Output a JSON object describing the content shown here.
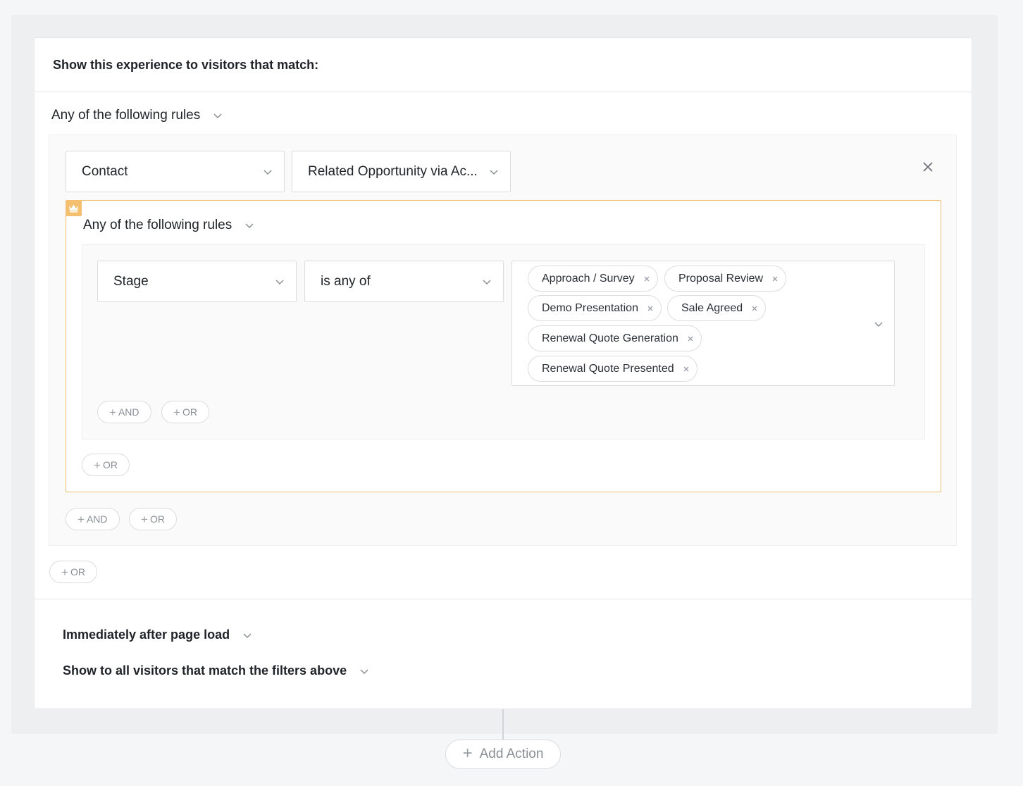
{
  "header": {
    "title": "Show this experience to visitors that match:"
  },
  "outer_rules": {
    "mode_label": "Any of the following rules"
  },
  "rule": {
    "object_select": "Contact",
    "relation_select": "Related Opportunity via Ac...",
    "nested": {
      "mode_label": "Any of the following rules",
      "field_select": "Stage",
      "operator_select": "is any of",
      "values": [
        "Approach / Survey",
        "Proposal Review",
        "Demo Presentation",
        "Sale Agreed",
        "Renewal Quote Generation",
        "Renewal Quote Presented"
      ],
      "and_label": "AND",
      "or_label": "OR",
      "group_or_label": "OR"
    },
    "and_label": "AND",
    "or_label": "OR"
  },
  "outer_or_label": "OR",
  "trigger": {
    "timing": "Immediately after page load",
    "audience": "Show to all visitors that match the filters above"
  },
  "add_action_label": "Add Action",
  "colors": {
    "premium_border": "#f0bd6e",
    "premium_badge": "#f4c06f"
  },
  "icons": {
    "remove": "close-icon",
    "dropdown": "chevron-down-icon",
    "premium": "crown-icon"
  }
}
